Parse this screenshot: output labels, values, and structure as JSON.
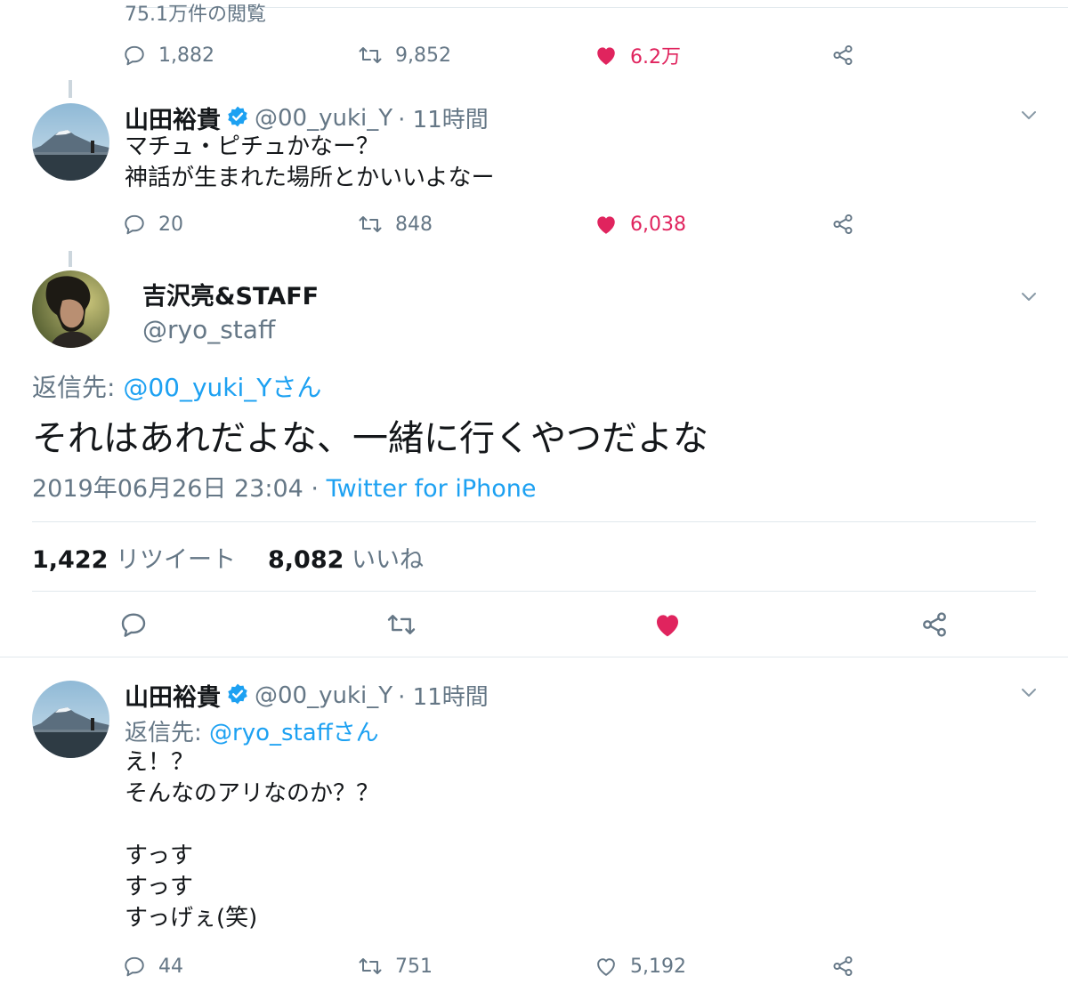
{
  "top_tweet": {
    "views": "75.1万件の閲覧",
    "replies": "1,882",
    "retweets": "9,852",
    "likes": "6.2万"
  },
  "tweet_yamada_1": {
    "name": "山田裕貴",
    "handle": "@00_yuki_Y",
    "time": "· 11時間",
    "lines": [
      "マチュ・ピチュかなー？",
      "神話が生まれた場所とかいいよなー"
    ],
    "replies": "20",
    "retweets": "848",
    "likes": "6,038"
  },
  "main_tweet": {
    "name": "吉沢亮&STAFF",
    "handle": "@ryo_staff",
    "reply_prefix": "返信先: ",
    "reply_to": "@00_yuki_Yさん",
    "text": "それはあれだよな、一緒に行くやつだよな",
    "date": "2019年06月26日 23:04 · ",
    "source": "Twitter for iPhone",
    "retweet_count": "1,422",
    "retweet_label": "リツイート",
    "like_count": "8,082",
    "like_label": "いいね"
  },
  "tweet_yamada_2": {
    "name": "山田裕貴",
    "handle": "@00_yuki_Y",
    "time": "· 11時間",
    "reply_prefix": "返信先: ",
    "reply_to": "@ryo_staffさん",
    "lines": [
      "え！？",
      "そんなのアリなのか？？",
      "",
      "すっす",
      "すっす",
      "すっげぇ(笑)"
    ],
    "replies": "44",
    "retweets": "751",
    "likes": "5,192"
  },
  "colors": {
    "like_active": "#e0245e",
    "link": "#1da1f2",
    "secondary_text": "#657786",
    "verified": "#1da1f2"
  },
  "icons": [
    "reply-icon",
    "retweet-icon",
    "heart-icon",
    "share-icon",
    "verified-badge-icon",
    "chevron-down-icon"
  ]
}
